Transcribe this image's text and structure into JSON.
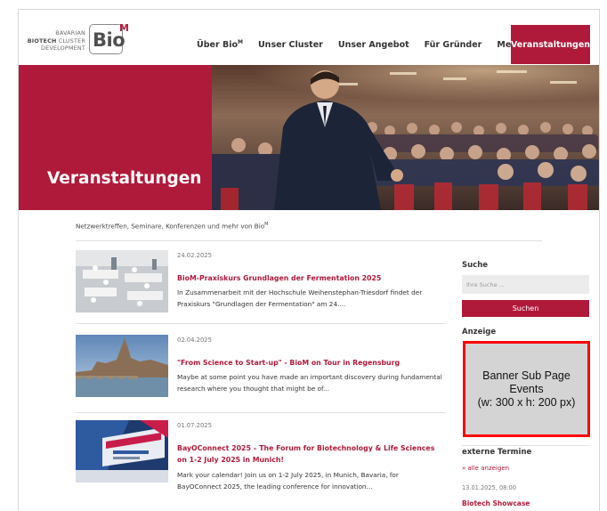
{
  "logo": {
    "line1": "BAVARIAN",
    "line2_bold": "BIOTECH",
    "line2_rest": " CLUSTER",
    "line3": "DEVELOPMENT",
    "brand": "Bio",
    "brand_sup": "M"
  },
  "nav": {
    "items": [
      {
        "label": "Über Bio",
        "sup": "M"
      },
      {
        "label": "Unser Cluster"
      },
      {
        "label": "Unser Angebot"
      },
      {
        "label": "Für Gründer"
      },
      {
        "label": "Mediathek"
      }
    ],
    "active": "Veranstaltungen"
  },
  "hero": {
    "title": "Veranstaltungen"
  },
  "intro": {
    "text": "Netzwerktreffen, Seminare, Konferenzen und mehr von Bio",
    "sup": "M"
  },
  "news": [
    {
      "date": "24.02.2025",
      "title": "BioM-Praxiskurs Grundlagen der Fermentation 2025",
      "excerpt": "In Zusammenarbeit mit der Hochschule Weihenstephan-Triesdorf findet der Praxiskurs \"Grundlagen der Fermentation\" am 24...."
    },
    {
      "date": "02.04.2025",
      "title": "\"From Science to Start-up\" - BioM on Tour in Regensburg",
      "excerpt": "Maybe at some point you have made an important discovery during funda­mental research where you thought that might be of..."
    },
    {
      "date": "01.07.2025",
      "title": "BayOConnect 2025 – The Forum for Biotechnology & Life Sciences on 1-2 July 2025 in Munich!",
      "excerpt": "Mark your calendar! Join us on 1-2 July 2025, in Munich, Bavaria, for BayOConnect 2025, the leading conference for innovation..."
    }
  ],
  "sidebar": {
    "search_heading": "Suche",
    "search_placeholder": "Ihre Suche ...",
    "search_button": "Suchen",
    "ad_heading": "Anzeige",
    "ad_line1": "Banner Sub Page",
    "ad_line2": "Events",
    "ad_line3": "(w: 300 x h: 200 px)",
    "external_heading": "externe Termine",
    "external_all": "» alle anzeigen",
    "external_date": "13.01.2025, 08:00",
    "external_title": "Biotech Showcase"
  },
  "colors": {
    "accent": "#b01a3a",
    "ad_border": "#ff0000",
    "ad_bg": "#d4d4d4"
  }
}
